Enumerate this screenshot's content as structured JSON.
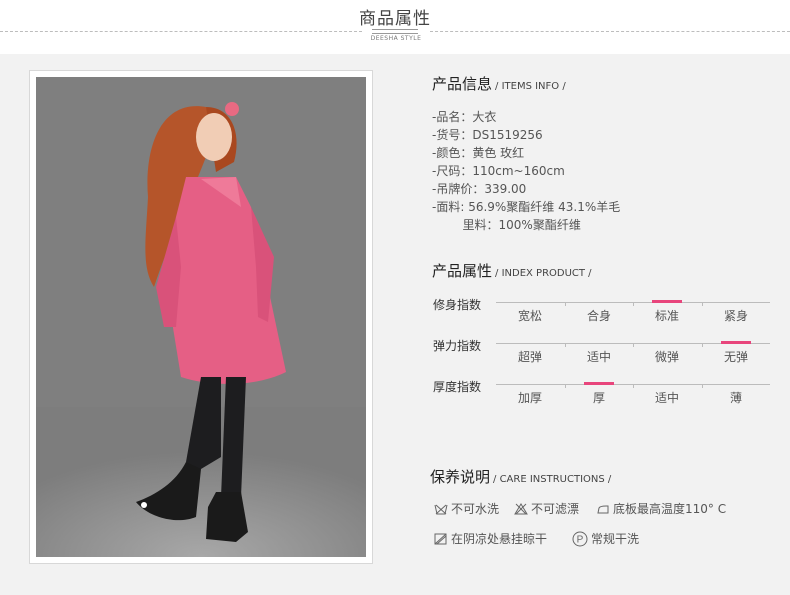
{
  "header": {
    "title": "商品属性",
    "brand": "DEESHA STYLE"
  },
  "items_info": {
    "title": "产品信息",
    "subtitle": "/ ITEMS INFO /",
    "lines": [
      "-品名：大衣",
      "-货号：DS1519256",
      "-颜色：黄色  玫红",
      "-尺码：110cm~160cm",
      "-吊牌价：339.00",
      "-面料: 56.9%聚酯纤维    43.1%羊毛",
      "        里料：100%聚酯纤维"
    ]
  },
  "index_product": {
    "title": "产品属性",
    "subtitle": "/ INDEX PRODUCT /",
    "rows": [
      {
        "label": "修身指数",
        "options": [
          "宽松",
          "合身",
          "标准",
          "紧身"
        ],
        "selected": 2
      },
      {
        "label": "弹力指数",
        "options": [
          "超弹",
          "适中",
          "微弹",
          "无弹"
        ],
        "selected": 3
      },
      {
        "label": "厚度指数",
        "options": [
          "加厚",
          "厚",
          "适中",
          "薄"
        ],
        "selected": 1
      }
    ],
    "accent": "#e8457c"
  },
  "care": {
    "title": "保养说明",
    "subtitle": "/ CARE INSTRUCTIONS /",
    "items": [
      {
        "icon": "no-wash-icon",
        "label": "不可水洗"
      },
      {
        "icon": "no-bleach-icon",
        "label": "不可滤漂"
      },
      {
        "icon": "iron-icon",
        "label": "底板最高温度110° C"
      },
      {
        "icon": "shade-dry-icon",
        "label": "在阴凉处悬挂晾干"
      },
      {
        "icon": "dry-clean-icon",
        "label": "常规干洗"
      }
    ]
  }
}
